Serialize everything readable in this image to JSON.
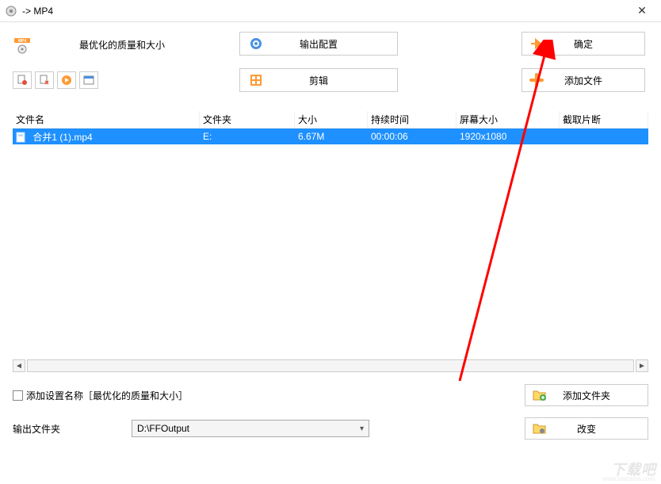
{
  "titlebar": {
    "title": "-> MP4"
  },
  "top": {
    "quality_label": "最优化的质量和大小",
    "output_config_label": "输出配置",
    "edit_label": "剪辑",
    "ok_label": "确定",
    "add_file_label": "添加文件"
  },
  "table": {
    "headers": {
      "name": "文件名",
      "folder": "文件夹",
      "size": "大小",
      "duration": "持续时间",
      "screen": "屏幕大小",
      "clip": "截取片断"
    },
    "rows": [
      {
        "name": "合并1 (1).mp4",
        "folder": "E:",
        "size": "6.67M",
        "duration": "00:00:06",
        "screen": "1920x1080",
        "clip": ""
      }
    ]
  },
  "bottom": {
    "add_settings_label": "添加设置名称［最优化的质量和大小］",
    "add_folder_label": "添加文件夹",
    "output_folder_label": "输出文件夹",
    "output_folder_value": "D:\\FFOutput",
    "change_label": "改变"
  },
  "watermark": {
    "main": "下载吧",
    "sub": "www.xiazaiba.com"
  }
}
